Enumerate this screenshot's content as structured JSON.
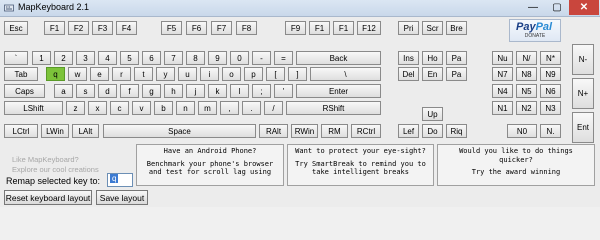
{
  "window": {
    "title": "MapKeyboard 2.1",
    "min_glyph": "—",
    "max_glyph": "▢",
    "close_glyph": "✕"
  },
  "keyboard": {
    "fn_row": [
      "Esc",
      "F1",
      "F2",
      "F3",
      "F4",
      "F5",
      "F6",
      "F7",
      "F8",
      "F9",
      "F1",
      "F1",
      "F12",
      "Pri",
      "Scr",
      "Bre"
    ],
    "num_row": [
      "`",
      "1",
      "2",
      "3",
      "4",
      "5",
      "6",
      "7",
      "8",
      "9",
      "0",
      "-",
      "=",
      "Back"
    ],
    "q_row": [
      "Tab",
      "q",
      "w",
      "e",
      "r",
      "t",
      "y",
      "u",
      "i",
      "o",
      "p",
      "[",
      "]",
      "\\"
    ],
    "a_row": [
      "Caps",
      "a",
      "s",
      "d",
      "f",
      "g",
      "h",
      "j",
      "k",
      "l",
      ";",
      "'",
      "Enter"
    ],
    "z_row": [
      "LShift",
      "z",
      "x",
      "c",
      "v",
      "b",
      "n",
      "m",
      ",",
      ".",
      "/",
      "RShift"
    ],
    "bottom_row": [
      "LCtrl",
      "LWin",
      "LAlt",
      "Space",
      "RAlt",
      "RWin",
      "RM",
      "RCtrl"
    ],
    "nav": [
      "Ins",
      "Ho",
      "Pa",
      "Del",
      "En",
      "Pa",
      "Up",
      "Lef",
      "Do",
      "Riq"
    ],
    "numpad": [
      "Nu",
      "N/",
      "N*",
      "N-",
      "N7",
      "N8",
      "N9",
      "N+",
      "N4",
      "N5",
      "N6",
      "N1",
      "N2",
      "N3",
      "Ent",
      "N0",
      "N."
    ],
    "selected_key": "q"
  },
  "paypal": {
    "brand_a": "Pay",
    "brand_b": "Pal",
    "sub": "DONATE"
  },
  "promo": {
    "line1": "Like MapKeyboard?",
    "line2": "Explore our cool creations"
  },
  "remap": {
    "label": "Remap selected key to:",
    "value": "q"
  },
  "buttons": {
    "reset": "Reset keyboard layout",
    "save": "Save layout"
  },
  "panels": [
    {
      "head": "Have an Android Phone?",
      "body": "Benchmark your phone's browser and test for scroll lag using"
    },
    {
      "head": "Want to protect your eye-sight?",
      "body": "Try SmartBreak to remind you to take intelligent breaks"
    },
    {
      "head": "Would you like to do things quicker?",
      "body": "Try the award winning"
    }
  ]
}
